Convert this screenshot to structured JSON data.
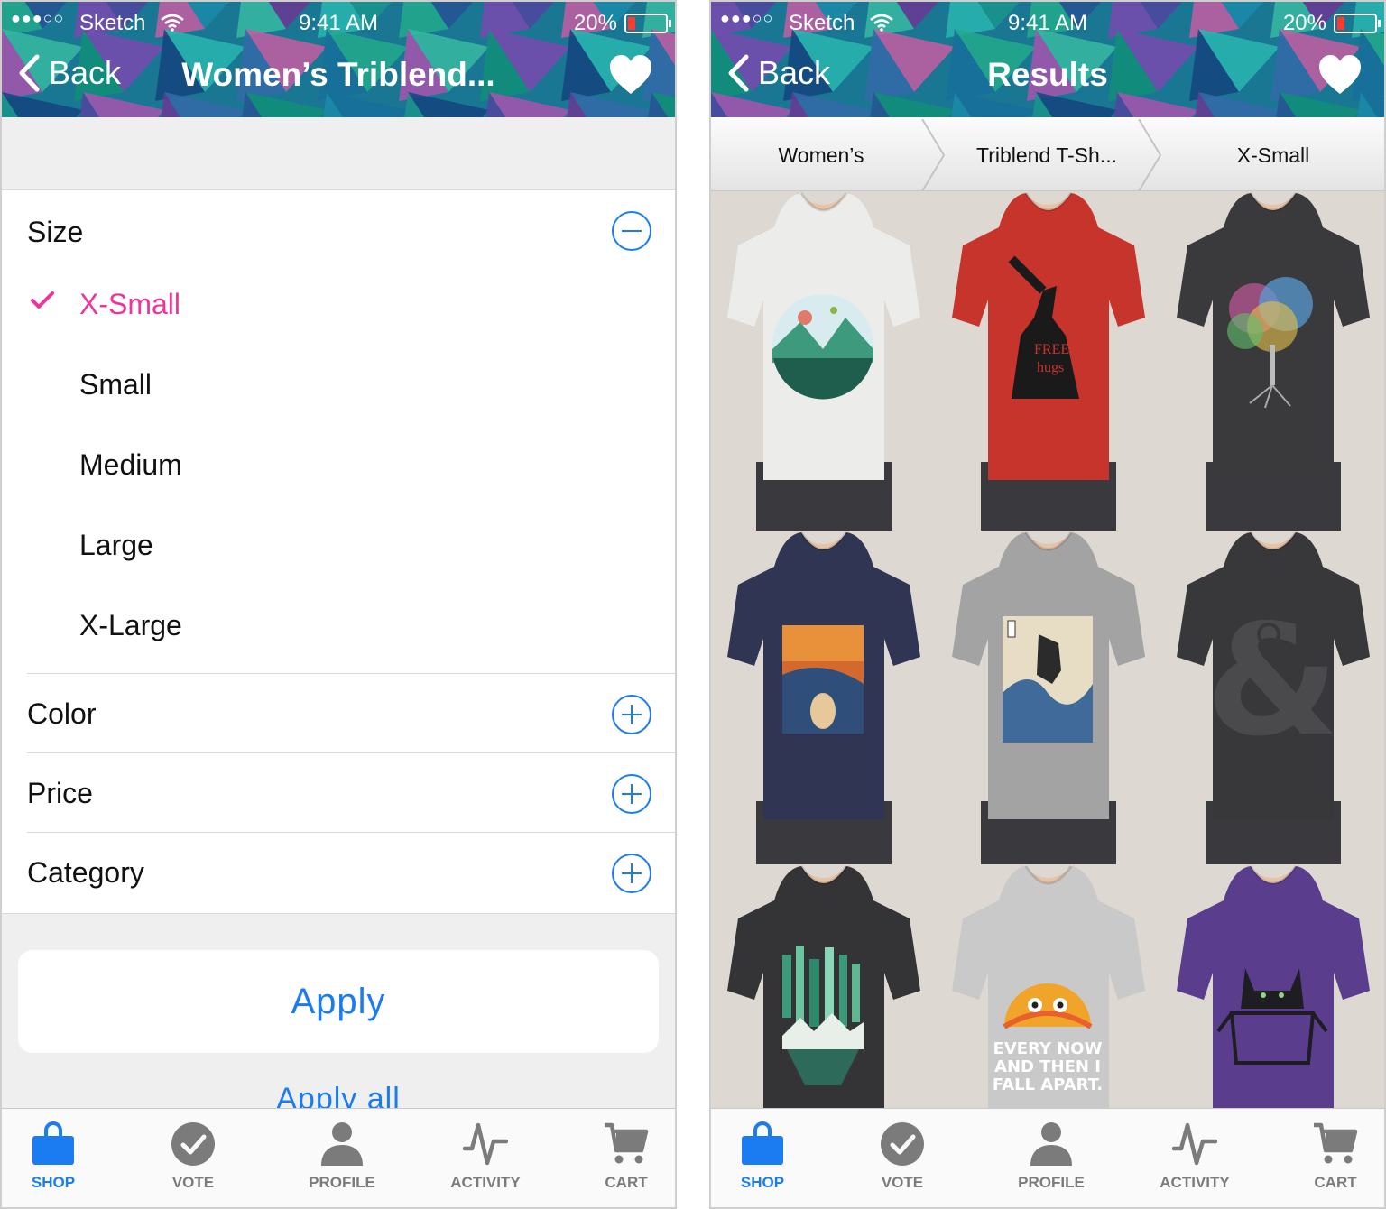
{
  "status": {
    "signal": "●●●○○",
    "carrier": "Sketch",
    "time": "9:41 AM",
    "battery": "20%"
  },
  "left": {
    "back_label": "Back",
    "title": "Women’s Triblend...",
    "size_label": "Size",
    "size_options": [
      {
        "label": "X-Small",
        "selected": true
      },
      {
        "label": "Small",
        "selected": false
      },
      {
        "label": "Medium",
        "selected": false
      },
      {
        "label": "Large",
        "selected": false
      },
      {
        "label": "X-Large",
        "selected": false
      }
    ],
    "sections": [
      {
        "label": "Color"
      },
      {
        "label": "Price"
      },
      {
        "label": "Category"
      }
    ],
    "apply_label": "Apply",
    "apply_all_label": "Apply all"
  },
  "right": {
    "back_label": "Back",
    "title": "Results",
    "breadcrumbs": [
      "Women’s",
      "Triblend T-Sh...",
      "X-Small"
    ],
    "products": [
      {
        "shirt_color": "#ececea",
        "design": "mountain-circle"
      },
      {
        "shirt_color": "#c7342c",
        "design": "free-hugs"
      },
      {
        "shirt_color": "#3a3a3c",
        "design": "rainbow-tree"
      },
      {
        "shirt_color": "#2f3553",
        "design": "scream"
      },
      {
        "shirt_color": "#a3a3a3",
        "design": "godzilla-wave"
      },
      {
        "shirt_color": "#38383a",
        "design": "ampersand"
      },
      {
        "shirt_color": "#343436",
        "design": "aurora-forest"
      },
      {
        "shirt_color": "#c9c9c9",
        "design": "taco"
      },
      {
        "shirt_color": "#5b3d8e",
        "design": "cat-box"
      }
    ]
  },
  "tabs": [
    {
      "label": "SHOP",
      "icon": "shopping-bag-icon",
      "active": true
    },
    {
      "label": "VOTE",
      "icon": "check-circle-icon",
      "active": false
    },
    {
      "label": "PROFILE",
      "icon": "person-icon",
      "active": false
    },
    {
      "label": "ACTIVITY",
      "icon": "activity-icon",
      "active": false
    },
    {
      "label": "CART",
      "icon": "cart-icon",
      "active": false
    }
  ],
  "colors": {
    "accent": "#1a7cf0",
    "selected": "#f0359a",
    "inactive_tab": "#7b7b7b"
  }
}
